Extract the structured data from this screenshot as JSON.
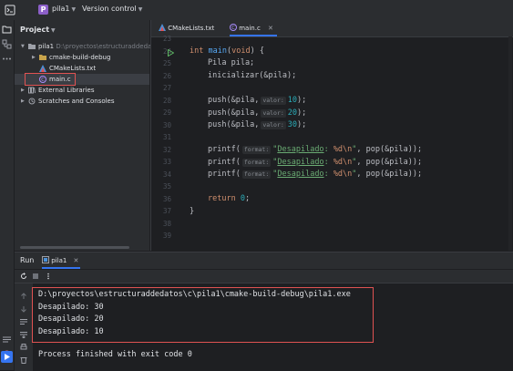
{
  "topbar": {
    "project_initial": "P",
    "project_name": "pila1",
    "version_control": "Version control"
  },
  "project_panel": {
    "header": "Project",
    "tree": {
      "root_name": "pila1",
      "root_path": "D:\\proyectos\\estructuraddedatos\\",
      "cmake_build": "cmake-build-debug",
      "cmakelists": "CMakeLists.txt",
      "main_c": "main.c",
      "external_libraries": "External Libraries",
      "scratches": "Scratches and Consoles"
    }
  },
  "editor": {
    "tabs": [
      {
        "label": "CMakeLists.txt"
      },
      {
        "label": "main.c"
      }
    ],
    "line_numbers": [
      "23",
      "24",
      "25",
      "26",
      "27",
      "28",
      "29",
      "30",
      "31",
      "32",
      "33",
      "34",
      "35",
      "36",
      "37",
      "38",
      "39"
    ],
    "code": {
      "l24_kw": "int",
      "l24_fn": "main",
      "l24_open": "(",
      "l24_kw2": "void",
      "l24_rest": ") {",
      "l25": "Pila pila;",
      "l26_fn": "inicializar",
      "l26_rest": "(&pila);",
      "push_fn": "push",
      "push_args": "(&pila,",
      "hint_valor": "valor:",
      "push_vals": [
        "10",
        "20",
        "30"
      ],
      "push_end": ");",
      "printf_fn": "printf",
      "printf_open": "(",
      "hint_format": "format:",
      "str_quote": "\"",
      "str_word": "Desapilado",
      "str_rest": ": ",
      "str_fmt": "%d\\n",
      "str_close": "\"",
      "printf_tail_a": ", ",
      "printf_pop": "pop",
      "printf_tail_b": "(&pila));",
      "return_kw": "return",
      "return_val": "0",
      "return_end": ";",
      "close_brace": "}"
    }
  },
  "run_panel": {
    "title": "Run",
    "tab_label": "pila1",
    "output_lines": [
      "D:\\proyectos\\estructuraddedatos\\c\\pila1\\cmake-build-debug\\pila1.exe",
      "Desapilado: 30",
      "Desapilado: 20",
      "Desapilado: 10",
      "",
      "Process finished with exit code 0"
    ]
  },
  "colors": {
    "accent": "#3574f0",
    "highlight_box": "#e05252",
    "project_badge": "#8c5fc8"
  }
}
